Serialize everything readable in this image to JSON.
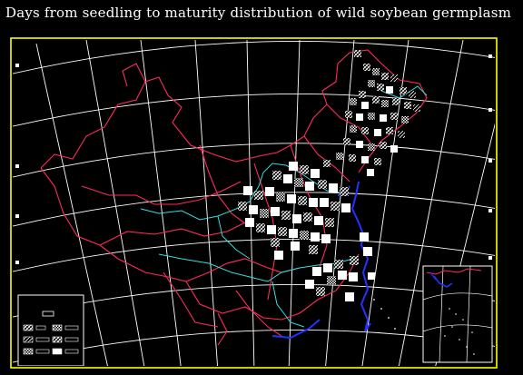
{
  "title": "Days from  seedling to maturity distribution of wild soybean germplasm",
  "colors": {
    "background": "#000000",
    "frame": "#ffff00",
    "graticule": "#ffffff",
    "border": "#ff2a5a",
    "river": "#33dddd",
    "coast": "#2233ff",
    "cell": "#ffffff"
  },
  "legend": {
    "visible_text": ""
  }
}
